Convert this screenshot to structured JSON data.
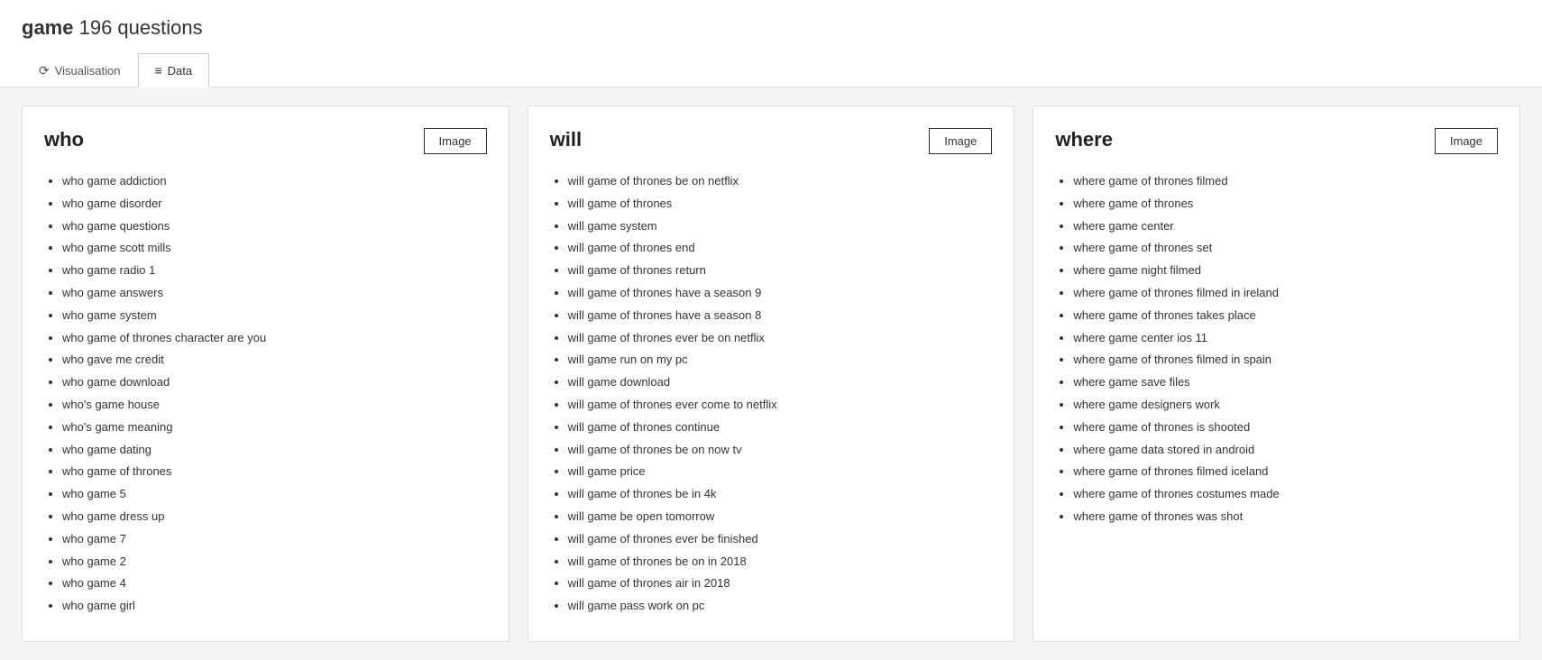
{
  "page": {
    "title_bold": "game",
    "title_rest": " 196 questions"
  },
  "tabs": [
    {
      "id": "visualisation",
      "label": "Visualisation",
      "icon": "⟳",
      "active": false
    },
    {
      "id": "data",
      "label": "Data",
      "icon": "≡",
      "active": true
    }
  ],
  "cards": [
    {
      "id": "who",
      "title": "who",
      "image_label": "Image",
      "items": [
        "who game addiction",
        "who game disorder",
        "who game questions",
        "who game scott mills",
        "who game radio 1",
        "who game answers",
        "who game system",
        "who game of thrones character are you",
        "who gave me credit",
        "who game download",
        "who's game house",
        "who's game meaning",
        "who game dating",
        "who game of thrones",
        "who game 5",
        "who game dress up",
        "who game 7",
        "who game 2",
        "who game 4",
        "who game girl"
      ]
    },
    {
      "id": "will",
      "title": "will",
      "image_label": "Image",
      "items": [
        "will game of thrones be on netflix",
        "will game of thrones",
        "will game system",
        "will game of thrones end",
        "will game of thrones return",
        "will game of thrones have a season 9",
        "will game of thrones have a season 8",
        "will game of thrones ever be on netflix",
        "will game run on my pc",
        "will game download",
        "will game of thrones ever come to netflix",
        "will game of thrones continue",
        "will game of thrones be on now tv",
        "will game price",
        "will game of thrones be in 4k",
        "will game be open tomorrow",
        "will game of thrones ever be finished",
        "will game of thrones be on in 2018",
        "will game of thrones air in 2018",
        "will game pass work on pc"
      ]
    },
    {
      "id": "where",
      "title": "where",
      "image_label": "Image",
      "items": [
        "where game of thrones filmed",
        "where game of thrones",
        "where game center",
        "where game of thrones set",
        "where game night filmed",
        "where game of thrones filmed in ireland",
        "where game of thrones takes place",
        "where game center ios 11",
        "where game of thrones filmed in spain",
        "where game save files",
        "where game designers work",
        "where game of thrones is shooted",
        "where game data stored in android",
        "where game of thrones filmed iceland",
        "where game of thrones costumes made",
        "where game of thrones was shot"
      ]
    }
  ]
}
